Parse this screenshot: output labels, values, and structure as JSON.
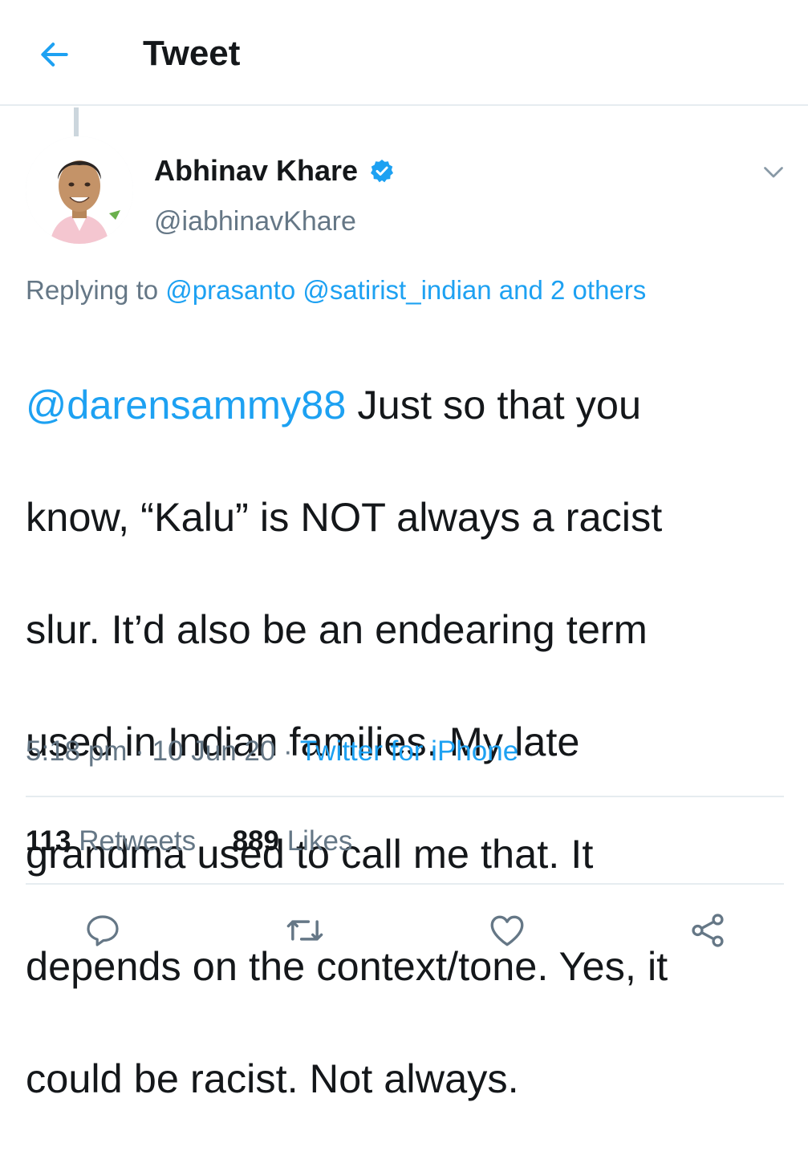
{
  "header": {
    "title": "Tweet",
    "back_icon": "arrow-left-icon",
    "accent": "#1da1f2"
  },
  "tweet": {
    "author": {
      "display_name": "Abhinav Khare",
      "handle": "@iabhinavKhare",
      "verified_icon": "verified-badge-icon"
    },
    "replying": {
      "prefix": "Replying to",
      "mentions": "@prasanto @satirist_indian and 2 others"
    },
    "text": {
      "mention": "@darensammy88",
      "line1_rest": " Just so that you",
      "line2": "know, “Kalu” is NOT always a racist",
      "line3": "slur. It’d also be an endearing term",
      "line4": "used in Indian families. My late",
      "line5": "grandma used to call me that. It",
      "line6": "depends on the context/tone. Yes, it",
      "line7": "could be racist. Not always."
    },
    "meta": {
      "time": "5:18 pm",
      "sep1": " · ",
      "date": "10 Jun 20",
      "sep2": " · ",
      "source": "Twitter for iPhone"
    },
    "stats": {
      "retweets_count": "113",
      "retweets_label": "Retweets",
      "likes_count": "889",
      "likes_label": "Likes"
    }
  },
  "actions": {
    "reply_icon": "reply-icon",
    "retweet_icon": "retweet-icon",
    "like_icon": "heart-icon",
    "share_icon": "share-icon"
  },
  "colors": {
    "text_primary": "#14171a",
    "text_secondary": "#657786",
    "link": "#1da1f2",
    "divider": "#e6ecf0"
  }
}
